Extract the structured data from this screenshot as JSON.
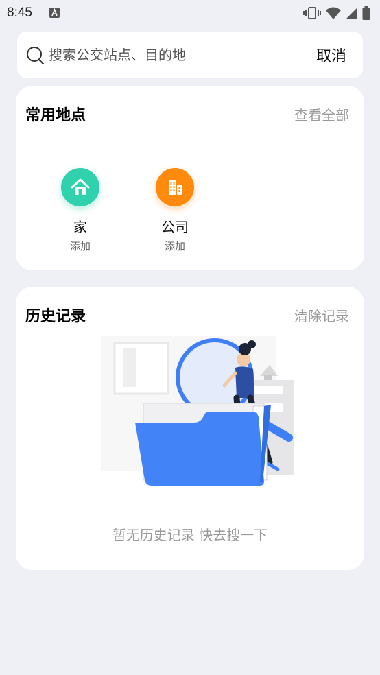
{
  "status_bar": {
    "time": "8:45"
  },
  "search": {
    "placeholder": "搜索公交站点、目的地",
    "cancel_label": "取消"
  },
  "frequent": {
    "title": "常用地点",
    "view_all_label": "查看全部",
    "places": [
      {
        "name": "家",
        "action": "添加",
        "icon": "home-icon",
        "color": "#30d1ad"
      },
      {
        "name": "公司",
        "action": "添加",
        "icon": "building-icon",
        "color": "#ff8a0e"
      }
    ]
  },
  "history": {
    "title": "历史记录",
    "clear_label": "清除记录",
    "empty_text": "暂无历史记录 快去搜一下"
  },
  "colors": {
    "accent": "#3f7ff6",
    "background": "#eef0f5"
  }
}
